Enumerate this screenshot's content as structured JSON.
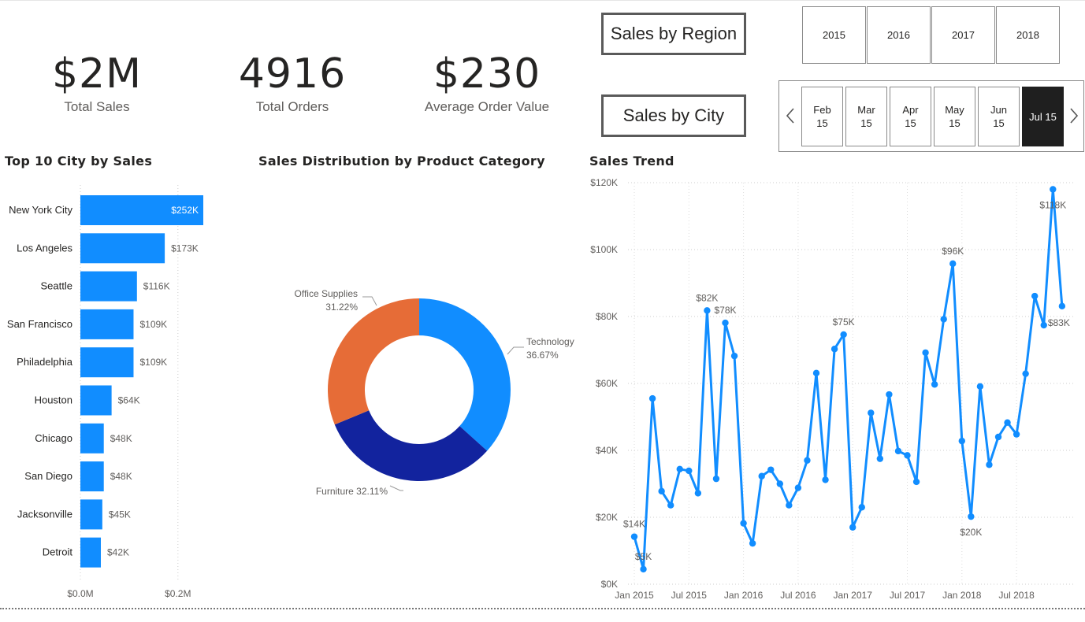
{
  "kpis": [
    {
      "value": "$2M",
      "label": "Total Sales"
    },
    {
      "value": "4916",
      "label": "Total Orders"
    },
    {
      "value": "$230",
      "label": "Average Order Value"
    }
  ],
  "nav": {
    "region_label": "Sales by Region",
    "city_label": "Sales by City"
  },
  "year_slicer": [
    "2015",
    "2016",
    "2017",
    "2018"
  ],
  "month_slicer": {
    "items": [
      {
        "label": "Feb\n15",
        "selected": false
      },
      {
        "label": "Mar\n15",
        "selected": false
      },
      {
        "label": "Apr\n15",
        "selected": false
      },
      {
        "label": "May\n15",
        "selected": false
      },
      {
        "label": "Jun\n15",
        "selected": false
      },
      {
        "label": "Jul 15",
        "selected": true
      }
    ],
    "prev_icon": "chevron-left-icon",
    "next_icon": "chevron-right-icon"
  },
  "colors": {
    "accent": "#118dff",
    "furniture": "#12239e",
    "office": "#e66c37",
    "selected": "#1f1f1f"
  },
  "chart_data": [
    {
      "type": "bar",
      "orientation": "horizontal",
      "title": "Top 10 City by Sales",
      "categories": [
        "New York City",
        "Los Angeles",
        "Seattle",
        "San Francisco",
        "Philadelphia",
        "Houston",
        "Chicago",
        "San Diego",
        "Jacksonville",
        "Detroit"
      ],
      "values": [
        252,
        173,
        116,
        109,
        109,
        64,
        48,
        48,
        45,
        42
      ],
      "value_labels": [
        "$252K",
        "$173K",
        "$116K",
        "$109K",
        "$109K",
        "$64K",
        "$48K",
        "$48K",
        "$45K",
        "$42K"
      ],
      "x_ticks": [
        "$0.0M",
        "$0.2M"
      ],
      "x_tick_values": [
        0,
        200
      ],
      "xlim": [
        0,
        252
      ],
      "grid": true
    },
    {
      "type": "pie",
      "donut": true,
      "title": "Sales Distribution by Product Category",
      "slices": [
        {
          "name": "Technology",
          "value": 36.67,
          "label": "36.67%",
          "color": "#118dff"
        },
        {
          "name": "Furniture",
          "value": 32.11,
          "label": "32.11%",
          "color": "#12239e"
        },
        {
          "name": "Office Supplies",
          "value": 31.22,
          "label": "31.22%",
          "color": "#e66c37"
        }
      ]
    },
    {
      "type": "line",
      "title": "Sales Trend",
      "y_ticks": [
        "$0K",
        "$20K",
        "$40K",
        "$60K",
        "$80K",
        "$100K",
        "$120K"
      ],
      "y_tick_values": [
        0,
        20,
        40,
        60,
        80,
        100,
        120
      ],
      "ylim": [
        0,
        120
      ],
      "x_ticks": [
        "Jan 2015",
        "Jul 2015",
        "Jan 2016",
        "Jul 2016",
        "Jan 2017",
        "Jul 2017",
        "Jan 2018",
        "Jul 2018"
      ],
      "x_tick_index": [
        0,
        6,
        12,
        18,
        24,
        30,
        36,
        42
      ],
      "values": [
        14.2,
        4.5,
        55.5,
        27.8,
        23.6,
        34.4,
        33.9,
        27.2,
        81.8,
        31.5,
        78.1,
        68.2,
        18.2,
        12.2,
        32.3,
        34.2,
        30.0,
        23.6,
        28.8,
        37.0,
        63.1,
        31.2,
        70.3,
        74.6,
        17.0,
        23.0,
        51.2,
        37.5,
        56.7,
        39.8,
        38.5,
        30.6,
        69.2,
        59.7,
        79.2,
        95.8,
        42.8,
        20.2,
        59.1,
        35.7,
        44.0,
        48.3,
        44.8,
        62.9,
        86.1,
        77.4,
        118.0,
        83.1
      ],
      "point_labels": [
        {
          "index": 0,
          "text": "$14K",
          "pos": "above"
        },
        {
          "index": 1,
          "text": "$5K",
          "pos": "above"
        },
        {
          "index": 8,
          "text": "$82K",
          "pos": "above"
        },
        {
          "index": 10,
          "text": "$78K",
          "pos": "above"
        },
        {
          "index": 23,
          "text": "$75K",
          "pos": "above"
        },
        {
          "index": 35,
          "text": "$96K",
          "pos": "above"
        },
        {
          "index": 37,
          "text": "$20K",
          "pos": "below"
        },
        {
          "index": 46,
          "text": "$118K",
          "pos": "below"
        },
        {
          "index": 47,
          "text": "$83K",
          "pos": "right"
        }
      ],
      "grid": true
    }
  ]
}
